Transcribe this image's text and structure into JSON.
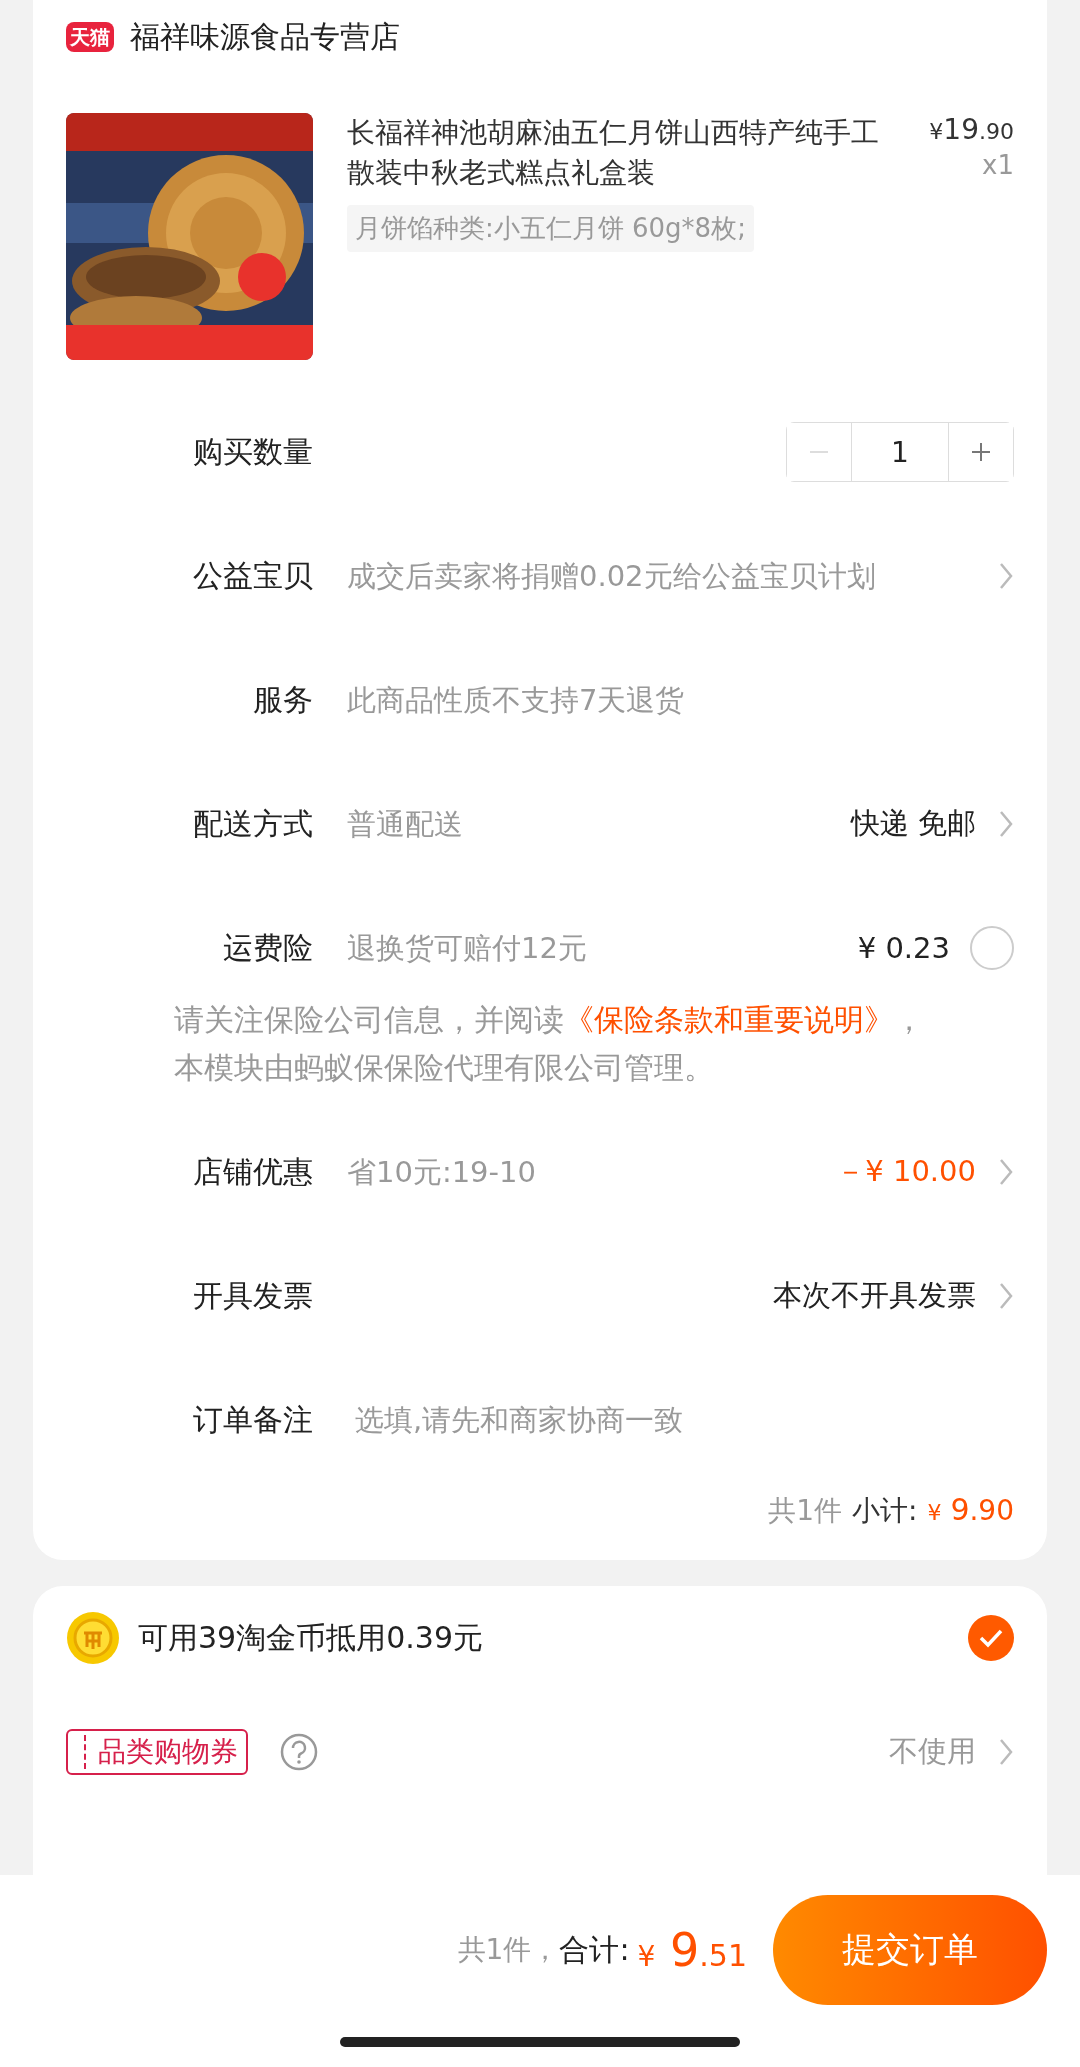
{
  "store": {
    "badge": "天猫",
    "name": "福祥味源食品专营店"
  },
  "product": {
    "kind": "picture",
    "title": "长福祥神池胡麻油五仁月饼山西特产纯手工散装中秋老式糕点礼盒装",
    "price_symbol": "¥",
    "price_integer": "19",
    "price_decimal": ".90",
    "quantity": "x1",
    "spec": "月饼馅种类:小五仁月饼 60g*8枚;"
  },
  "rows": [
    {
      "kind": "quantity",
      "label": "购买数量",
      "value": "1",
      "minus_disabled": true
    },
    {
      "kind": "row",
      "label": "公益宝贝",
      "text": "成交后卖家将捐赠0.02元给公益宝贝计划",
      "chevron": true
    },
    {
      "kind": "row",
      "label": "服务",
      "text": "此商品性质不支持7天退货"
    },
    {
      "kind": "row",
      "label": "配送方式",
      "text": "普通配送",
      "value": "快递 免邮",
      "chevron": true
    },
    {
      "kind": "check",
      "label": "运费险",
      "text": "退换货可赔付12元",
      "value": "¥ 0.23",
      "checked": false
    },
    {
      "kind": "notice",
      "before": "请关注保险公司信息，并阅读",
      "link": "《保险条款和重要说明》",
      "after": "，本模块由蚂蚁保保险代理有限公司管理。"
    },
    {
      "kind": "row",
      "label": "店铺优惠",
      "text": "省10元:19-10",
      "value": "－¥ 10.00",
      "accent": true,
      "chevron": true
    },
    {
      "kind": "row",
      "label": "开具发票",
      "value": "本次不开具发票",
      "chevron": true
    },
    {
      "kind": "remark",
      "label": "订单备注",
      "placeholder": "选填,请先和商家协商一致"
    }
  ],
  "subtotal": {
    "count": "共1件",
    "label": "小计:",
    "symbol": "¥",
    "integer": "9",
    "decimal": ".90"
  },
  "coins": {
    "text": "可用39淘金币抵用0.39元",
    "checked": true
  },
  "coupon": {
    "tag": "品类购物券",
    "value": "不使用"
  },
  "footer": {
    "count": "共1件，",
    "label": "合计:",
    "symbol": "¥",
    "integer": "9",
    "decimal": ".51",
    "button": "提交订单"
  }
}
